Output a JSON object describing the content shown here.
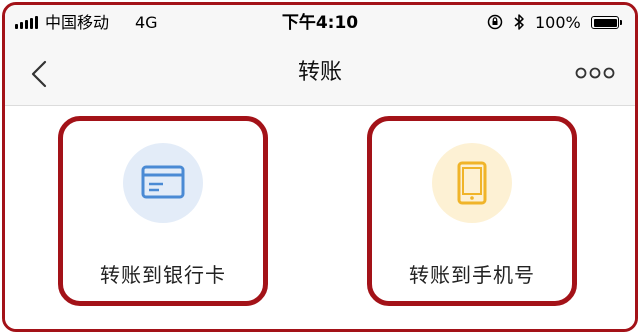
{
  "status_bar": {
    "carrier": "中国移动",
    "network": "4G",
    "time": "下午4:10",
    "battery_percent": "100%",
    "battery_level": 1.0
  },
  "nav": {
    "title": "转账",
    "back_icon": "chevron-left-icon",
    "more_icon": "more-dots-icon"
  },
  "options": [
    {
      "label": "转账到银行卡",
      "icon": "bank-card-icon",
      "icon_color": "#4a8ad4",
      "circle_color": "#e3ecf8"
    },
    {
      "label": "转账到手机号",
      "icon": "mobile-phone-icon",
      "icon_color": "#f0b429",
      "circle_color": "#fdf1d4"
    }
  ],
  "colors": {
    "highlight_border": "#a31218",
    "bar_background": "#f7f7f7"
  }
}
